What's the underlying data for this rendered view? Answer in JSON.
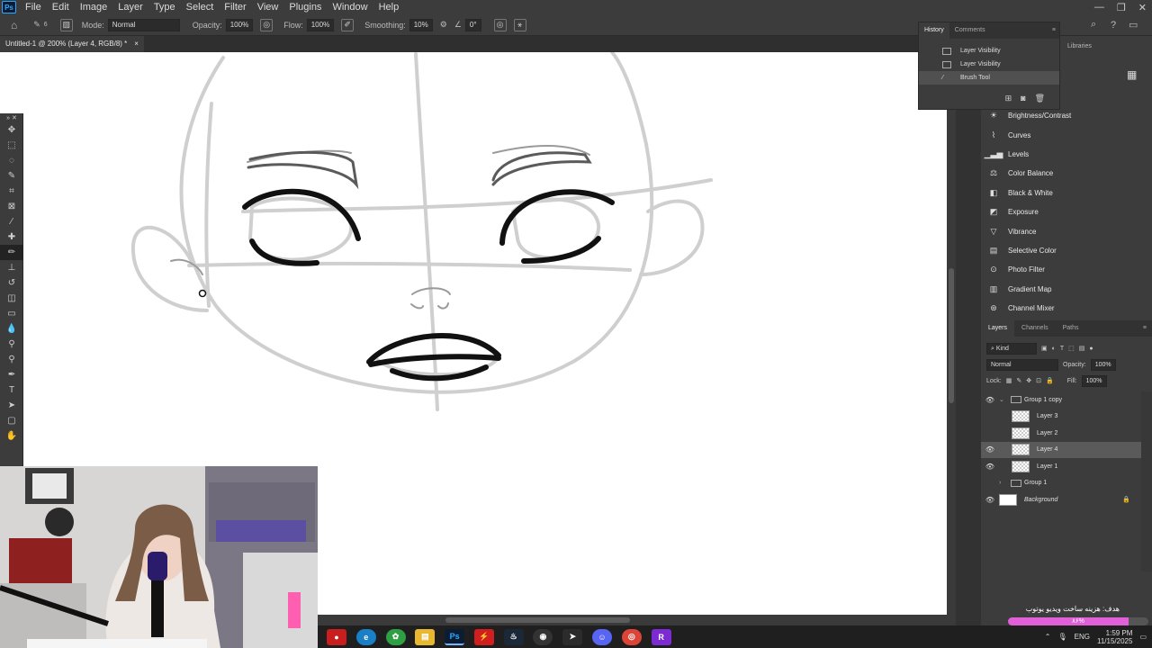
{
  "app": {
    "logo": "Ps"
  },
  "menu": [
    "File",
    "Edit",
    "Image",
    "Layer",
    "Type",
    "Select",
    "Filter",
    "View",
    "Plugins",
    "Window",
    "Help"
  ],
  "options": {
    "brush_size": "6",
    "mode_label": "Mode:",
    "mode_value": "Normal",
    "opacity_label": "Opacity:",
    "opacity_value": "100%",
    "flow_label": "Flow:",
    "flow_value": "100%",
    "smoothing_label": "Smoothing:",
    "smoothing_value": "10%",
    "angle_value": "0°"
  },
  "document": {
    "tab_title": "Untitled-1 @ 200% (Layer 4, RGB/8) *",
    "close": "×"
  },
  "history": {
    "tabs": [
      "History",
      "Comments"
    ],
    "items": [
      {
        "label": "Layer Visibility",
        "active": false
      },
      {
        "label": "Layer Visibility",
        "active": false
      },
      {
        "label": "Brush Tool",
        "active": true
      }
    ]
  },
  "libraries_tab": "Libraries",
  "adjustments": [
    {
      "label": "Brightness/Contrast",
      "icon": "sun-icon"
    },
    {
      "label": "Curves",
      "icon": "curves-icon"
    },
    {
      "label": "Levels",
      "icon": "levels-icon"
    },
    {
      "label": "Color Balance",
      "icon": "color-balance-icon"
    },
    {
      "label": "Black & White",
      "icon": "black-white-icon"
    },
    {
      "label": "Exposure",
      "icon": "exposure-icon"
    },
    {
      "label": "Vibrance",
      "icon": "vibrance-icon"
    },
    {
      "label": "Selective Color",
      "icon": "selective-color-icon"
    },
    {
      "label": "Photo Filter",
      "icon": "camera-icon"
    },
    {
      "label": "Gradient Map",
      "icon": "gradient-map-icon"
    },
    {
      "label": "Channel Mixer",
      "icon": "channel-mixer-icon"
    }
  ],
  "layers_panel": {
    "tabs": [
      "Layers",
      "Channels",
      "Paths"
    ],
    "kind": "Kind",
    "blend_mode": "Normal",
    "opacity_label": "Opacity:",
    "opacity_value": "100%",
    "lock_label": "Lock:",
    "fill_label": "Fill:",
    "fill_value": "100%",
    "layers": [
      {
        "name": "Group 1 copy",
        "type": "group",
        "visible": true,
        "expanded": true,
        "selected": false
      },
      {
        "name": "Layer 3",
        "type": "layer",
        "visible": false,
        "selected": false
      },
      {
        "name": "Layer 2",
        "type": "layer",
        "visible": false,
        "selected": false
      },
      {
        "name": "Layer 4",
        "type": "layer",
        "visible": true,
        "selected": true
      },
      {
        "name": "Layer 1",
        "type": "layer",
        "visible": true,
        "selected": false
      },
      {
        "name": "Group 1",
        "type": "group",
        "visible": false,
        "expanded": false,
        "selected": false
      },
      {
        "name": "Background",
        "type": "background",
        "visible": true,
        "selected": false
      }
    ]
  },
  "goal": {
    "title": "هدف: هزینه ساخت ویدیو یوتوب",
    "percent_text": "۸۶%",
    "progress": 0.86
  },
  "tray": {
    "lang": "ENG",
    "time": "1:59 PM",
    "date": "11/15/2025"
  },
  "taskbar_apps": [
    "record-app",
    "edge",
    "android-app",
    "file-explorer",
    "photoshop",
    "red-app",
    "steam",
    "obs",
    "cursor-app",
    "discord",
    "chrome",
    "rider"
  ],
  "colors": {
    "accent": "#31a8ff",
    "goal_fill": "#e060d8",
    "panel_bg": "#3c3c3c"
  }
}
